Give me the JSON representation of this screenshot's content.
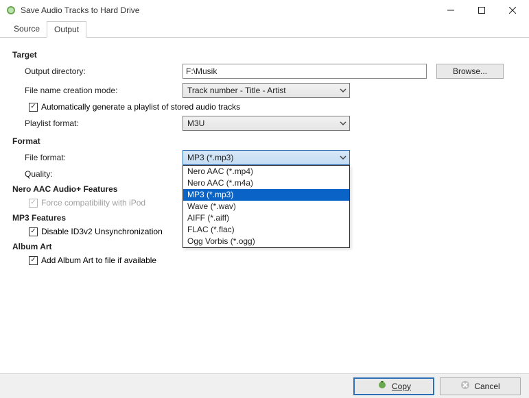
{
  "titlebar": {
    "title": "Save Audio Tracks to Hard Drive"
  },
  "tabs": {
    "source": "Source",
    "output": "Output"
  },
  "target": {
    "header": "Target",
    "output_dir_label": "Output directory:",
    "output_dir_value": "F:\\Musik",
    "browse": "Browse...",
    "fncm_label": "File name creation mode:",
    "fncm_value": "Track number - Title - Artist",
    "autoplaylist": "Automatically generate a playlist of stored audio tracks",
    "playlistfmt_label": "Playlist format:",
    "playlistfmt_value": "M3U"
  },
  "format": {
    "header": "Format",
    "fileformat_label": "File format:",
    "fileformat_value": "MP3 (*.mp3)",
    "quality_label": "Quality:",
    "options": [
      "Nero AAC (*.mp4)",
      "Nero AAC (*.m4a)",
      "MP3 (*.mp3)",
      "Wave (*.wav)",
      "AIFF (*.aiff)",
      "FLAC (*.flac)",
      "Ogg Vorbis (*.ogg)"
    ],
    "selected_index": 2
  },
  "neroaac": {
    "header": "Nero AAC Audio+ Features",
    "ipod": "Force compatibility with iPod"
  },
  "mp3feat": {
    "header": "MP3 Features",
    "id3": "Disable ID3v2 Unsynchronization"
  },
  "albumart": {
    "header": "Album Art",
    "add": "Add Album Art to file if available"
  },
  "footer": {
    "copy": "Copy",
    "cancel": "Cancel"
  }
}
